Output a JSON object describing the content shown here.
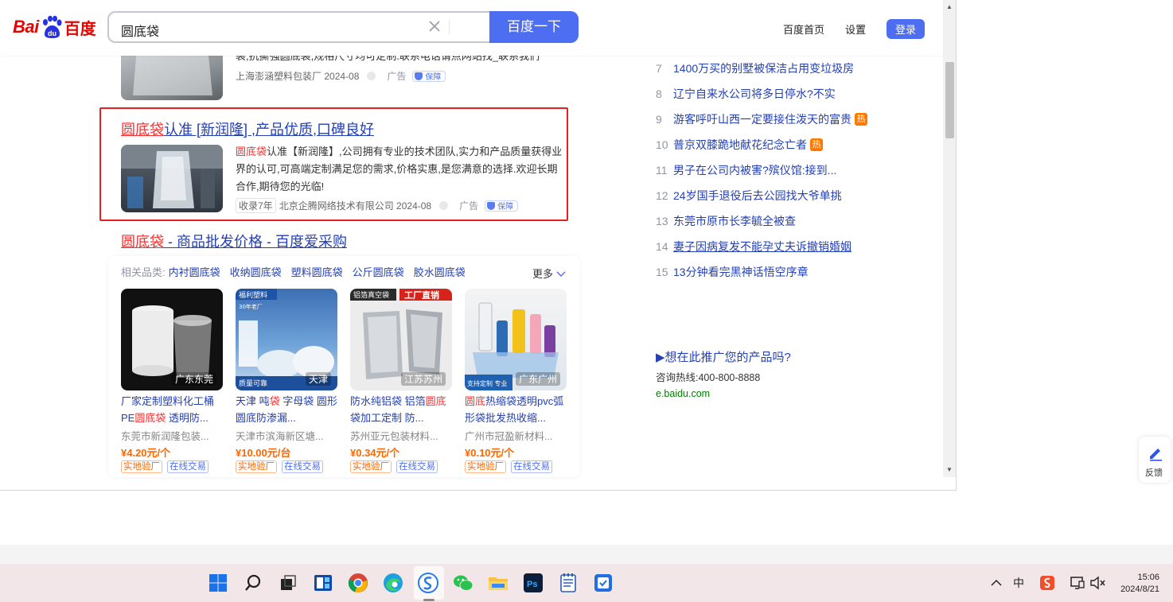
{
  "header": {
    "logo_bai": "Bai",
    "logo_cn": "百度",
    "search_query": "圆底袋",
    "search_button": "百度一下",
    "nav_home": "百度首页",
    "nav_settings": "设置",
    "nav_login": "登录"
  },
  "results": {
    "r0": {
      "snippet_partial": "袋,抗撕强圆底袋,规格尺寸均可定制.联系电话请点网站找_联系我们",
      "source": "上海澎涵塑料包装厂",
      "date": "2024-08",
      "ad": "广告",
      "guarantee": "保障"
    },
    "r1": {
      "title_hl": "圆底袋",
      "title_rest": "认准 [新润隆] ,产品优质,口碑良好",
      "snippet_hl": "圆底袋",
      "snippet_rest": "认准【新润隆】,公司拥有专业的技术团队,实力和产品质量获得业界的认可,可高端定制满足您的需求,价格实惠,是您满意的选择.欢迎长期合作,期待您的光临!",
      "badge": "收录7年",
      "source": "北京企腾网络技术有限公司",
      "date": "2024-08",
      "ad": "广告",
      "guarantee": "保障"
    },
    "r2": {
      "title_hl": "圆底袋",
      "title_rest": " - 商品批发价格 - 百度爱采购"
    }
  },
  "products": {
    "categories_label": "相关品类:",
    "categories": [
      "内衬圆底袋",
      "收纳圆底袋",
      "塑料圆底袋",
      "公斤圆底袋",
      "胶水圆底袋"
    ],
    "more": "更多",
    "items": [
      {
        "location": "广东东莞",
        "name_a": "厂家定制塑料化工桶PE",
        "name_hl": "圆底袋",
        "name_b": " 透明防...",
        "seller": "东莞市新润隆包装...",
        "price": "¥4.20元/个",
        "tag1": "实地验厂",
        "tag2": "在线交易"
      },
      {
        "location": "天津",
        "name_a": "天津 吨",
        "name_hl": "袋",
        "name_b": " 字母袋 圆形圆底防渗漏...",
        "seller": "天津市滨海新区塘...",
        "price": "¥10.00元/台",
        "tag1": "实地验厂",
        "tag2": "在线交易",
        "img_text1": "福利塑料",
        "img_text2": "30年老厂",
        "img_text3": "质量可靠"
      },
      {
        "location": "江苏苏州",
        "name_a": "防水纯铝袋 铝箔",
        "name_hl": "圆底",
        "name_b": "袋加工定制 防...",
        "seller": "苏州亚元包装材料...",
        "price": "¥0.34元/个",
        "tag1": "实地验厂",
        "tag2": "在线交易",
        "img_text1": "铝箔真空袋",
        "img_text2": "工厂直销"
      },
      {
        "location": "广东广州",
        "name_a": "",
        "name_hl": "圆底",
        "name_b": "热缩袋透明pvc弧形袋批发热收缩...",
        "seller": "广州市冠盈新材料...",
        "price": "¥0.10元/个",
        "tag1": "实地验厂",
        "tag2": "在线交易",
        "img_text1": "支持定制 专业"
      }
    ]
  },
  "hot_list": [
    {
      "n": "7",
      "t": "1400万买的别墅被保洁占用变垃圾房",
      "tag": ""
    },
    {
      "n": "8",
      "t": "辽宁自来水公司将多日停水?不实",
      "tag": ""
    },
    {
      "n": "9",
      "t": "游客呼吁山西一定要接住泼天的富贵",
      "tag": "热"
    },
    {
      "n": "10",
      "t": "普京双膝跪地献花纪念亡者",
      "tag": "热"
    },
    {
      "n": "11",
      "t": "男子在公司内被害?殡仪馆:接到...",
      "tag": ""
    },
    {
      "n": "12",
      "t": "24岁国手退役后去公园找大爷单挑",
      "tag": ""
    },
    {
      "n": "13",
      "t": "东莞市原市长李毓全被查",
      "tag": ""
    },
    {
      "n": "14",
      "t": "妻子因病复发不能孕丈夫诉撤销婚姻",
      "tag": ""
    },
    {
      "n": "15",
      "t": "13分钟看完黑神话悟空序章",
      "tag": ""
    }
  ],
  "promo": {
    "title": "▶想在此推广您的产品吗?",
    "hotline": "咨询热线:400-800-8888",
    "url": "e.baidu.com"
  },
  "feedback": "反馈",
  "taskbar": {
    "time": "15:06",
    "date": "2024/8/21",
    "ime": "中"
  },
  "colors": {
    "brand_blue": "#4e6ef2",
    "link_blue": "#2440b3",
    "highlight_red": "#f73131",
    "price_orange": "#ff6600",
    "hot_orange": "#ff7800"
  }
}
